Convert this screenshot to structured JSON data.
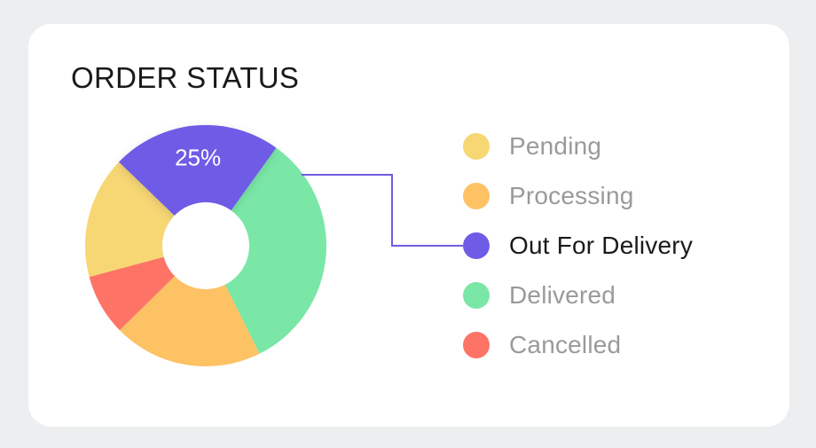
{
  "chart_data": {
    "type": "pie",
    "variant": "donut",
    "title": "ORDER STATUS",
    "categories": [
      "Pending",
      "Processing",
      "Out For Delivery",
      "Delivered",
      "Cancelled"
    ],
    "values": [
      18,
      22,
      25,
      36,
      9
    ],
    "colors": [
      "#f7d774",
      "#fcc264",
      "#6e5ce6",
      "#7ae7a7",
      "#fd7466"
    ],
    "highlighted": "Out For Delivery",
    "data_labels": {
      "Out For Delivery": "25%"
    },
    "legend_position": "right"
  }
}
